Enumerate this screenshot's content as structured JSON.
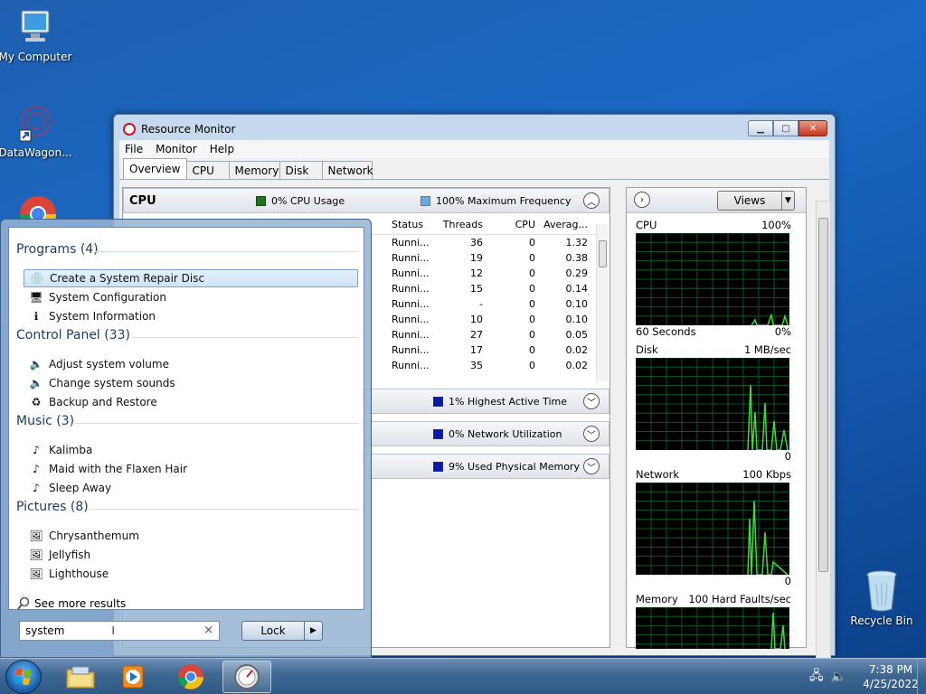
{
  "desktop": {
    "icons": [
      {
        "label": "My Computer"
      },
      {
        "label": "DataWagon..."
      },
      {
        "label": "Recycle Bin"
      }
    ]
  },
  "resource_monitor": {
    "title": "Resource Monitor",
    "menu": [
      "File",
      "Monitor",
      "Help"
    ],
    "tabs": [
      "Overview",
      "CPU",
      "Memory",
      "Disk",
      "Network"
    ],
    "active_tab": "Overview",
    "cpu_section": {
      "title": "CPU",
      "metric1": "0% CPU Usage",
      "metric2": "100% Maximum Frequency",
      "metric1_color": "#1a7a1a",
      "metric2_color": "#6fa8dc",
      "columns": [
        "Status",
        "Threads",
        "CPU",
        "Averag..."
      ],
      "rows": [
        {
          "status": "Runni...",
          "threads": "36",
          "cpu": "0",
          "avg": "1.32"
        },
        {
          "status": "Runni...",
          "threads": "19",
          "cpu": "0",
          "avg": "0.38"
        },
        {
          "status": "Runni...",
          "threads": "12",
          "cpu": "0",
          "avg": "0.29"
        },
        {
          "status": "Runni...",
          "threads": "15",
          "cpu": "0",
          "avg": "0.14"
        },
        {
          "status": "Runni...",
          "threads": "-",
          "cpu": "0",
          "avg": "0.10"
        },
        {
          "status": "Runni...",
          "threads": "10",
          "cpu": "0",
          "avg": "0.10"
        },
        {
          "status": "Runni...",
          "threads": "27",
          "cpu": "0",
          "avg": "0.05"
        },
        {
          "status": "Runni...",
          "threads": "17",
          "cpu": "0",
          "avg": "0.02"
        },
        {
          "status": "Runni...",
          "threads": "35",
          "cpu": "0",
          "avg": "0.02"
        }
      ]
    },
    "disk_section": {
      "metric": "1% Highest Active Time"
    },
    "network_section": {
      "metric": "0% Network Utilization"
    },
    "memory_section": {
      "metric": "9% Used Physical Memory"
    },
    "section_color": "#0a1aa8",
    "views_label": "Views",
    "graphs": [
      {
        "label": "CPU",
        "scale": "100%",
        "bottom_left": "60 Seconds",
        "bottom_right": "0%"
      },
      {
        "label": "Disk",
        "scale": "1 MB/sec",
        "bottom_left": "",
        "bottom_right": "0"
      },
      {
        "label": "Network",
        "scale": "100 Kbps",
        "bottom_left": "",
        "bottom_right": "0"
      },
      {
        "label": "Memory",
        "scale": "100 Hard Faults/sec",
        "bottom_left": "",
        "bottom_right": ""
      }
    ]
  },
  "start_menu": {
    "categories": [
      {
        "title": "Programs (4)",
        "items": [
          {
            "label": "Create a System Repair Disc",
            "icon": "repair-disc-icon"
          },
          {
            "label": "System Configuration",
            "icon": "system-config-icon"
          },
          {
            "label": "System Information",
            "icon": "system-info-icon"
          }
        ]
      },
      {
        "title": "Control Panel (33)",
        "items": [
          {
            "label": "Adjust system volume",
            "icon": "speaker-icon"
          },
          {
            "label": "Change system sounds",
            "icon": "speaker-icon"
          },
          {
            "label": "Backup and Restore",
            "icon": "backup-icon"
          }
        ]
      },
      {
        "title": "Music (3)",
        "items": [
          {
            "label": "Kalimba",
            "icon": "music-file-icon"
          },
          {
            "label": "Maid with the Flaxen Hair",
            "icon": "music-file-icon"
          },
          {
            "label": "Sleep Away",
            "icon": "music-file-icon"
          }
        ]
      },
      {
        "title": "Pictures (8)",
        "items": [
          {
            "label": "Chrysanthemum",
            "icon": "picture-file-icon"
          },
          {
            "label": "Jellyfish",
            "icon": "picture-file-icon"
          },
          {
            "label": "Lighthouse",
            "icon": "picture-file-icon"
          }
        ]
      }
    ],
    "see_more": "See more results",
    "search_value": "system",
    "clear_glyph": "×",
    "lock_label": "Lock"
  },
  "taskbar": {
    "time": "7:38 PM",
    "date": "4/25/2022"
  }
}
